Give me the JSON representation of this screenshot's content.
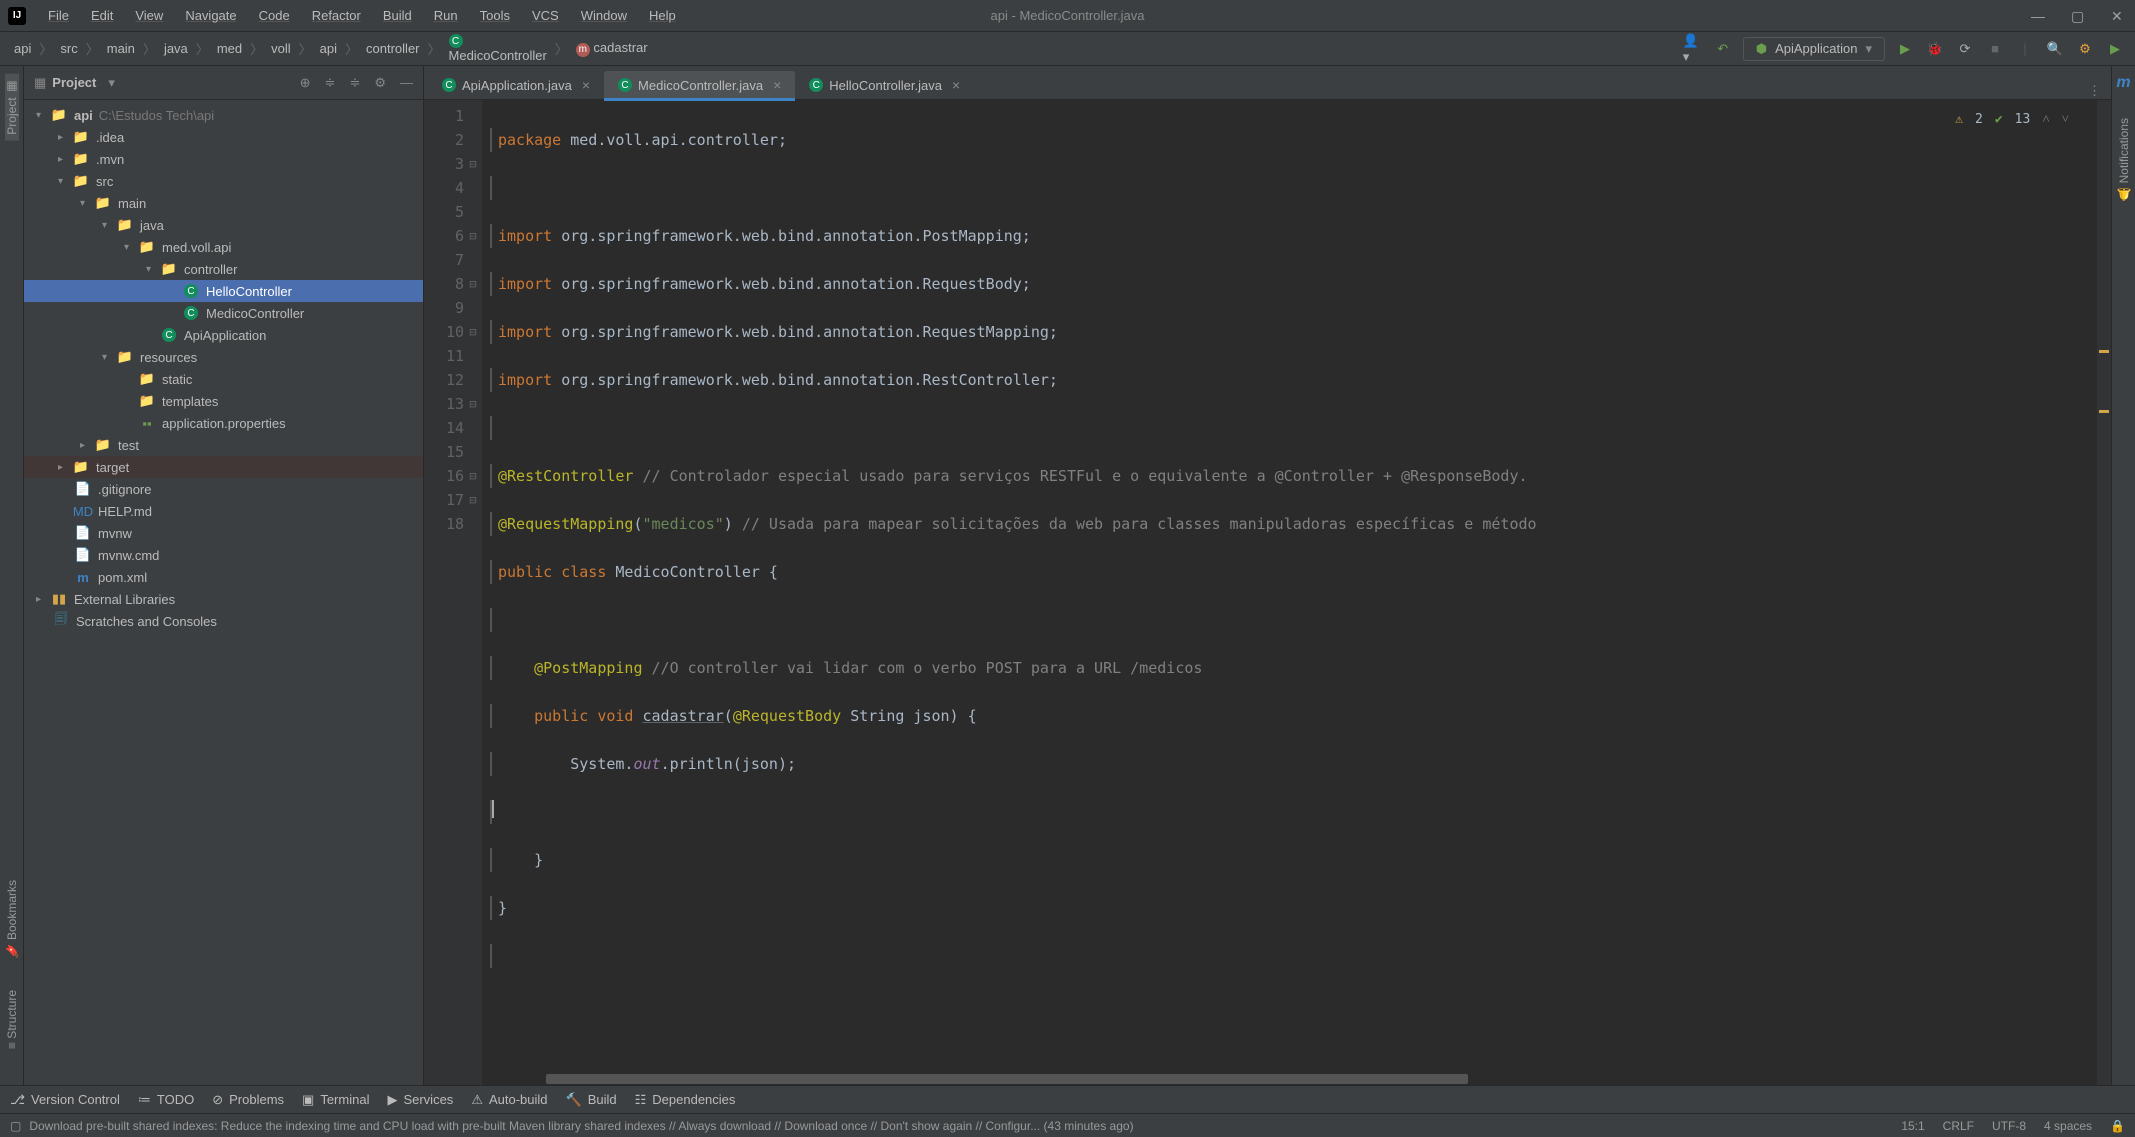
{
  "window": {
    "title": "api - MedicoController.java"
  },
  "menu": [
    "File",
    "Edit",
    "View",
    "Navigate",
    "Code",
    "Refactor",
    "Build",
    "Run",
    "Tools",
    "VCS",
    "Window",
    "Help"
  ],
  "breadcrumb": [
    {
      "label": "api",
      "icon": null
    },
    {
      "label": "src",
      "icon": "folder"
    },
    {
      "label": "main",
      "icon": null
    },
    {
      "label": "java",
      "icon": null
    },
    {
      "label": "med",
      "icon": null
    },
    {
      "label": "voll",
      "icon": null
    },
    {
      "label": "api",
      "icon": null
    },
    {
      "label": "controller",
      "icon": null
    },
    {
      "label": "MedicoController",
      "icon": "class"
    },
    {
      "label": "cadastrar",
      "icon": "method"
    }
  ],
  "run_config": "ApiApplication",
  "project_panel": {
    "title": "Project"
  },
  "tree": {
    "root_name": "api",
    "root_hint": "C:\\Estudos Tech\\api",
    "idea": ".idea",
    "mvn": ".mvn",
    "src": "src",
    "main": "main",
    "java": "java",
    "pkg": "med.voll.api",
    "controller": "controller",
    "hello": "HelloController",
    "medico": "MedicoController",
    "app": "ApiApplication",
    "resources": "resources",
    "static": "static",
    "templates": "templates",
    "props": "application.properties",
    "test": "test",
    "target": "target",
    "gitignore": ".gitignore",
    "help": "HELP.md",
    "mvnw": "mvnw",
    "mvnwcmd": "mvnw.cmd",
    "pom": "pom.xml",
    "ext": "External Libraries",
    "scratch": "Scratches and Consoles"
  },
  "tabs": [
    {
      "label": "ApiApplication.java",
      "active": false
    },
    {
      "label": "MedicoController.java",
      "active": true
    },
    {
      "label": "HelloController.java",
      "active": false
    }
  ],
  "inspections": {
    "warn_count": "2",
    "pass_count": "13"
  },
  "gutter_lines": [
    "1",
    "2",
    "3",
    "4",
    "5",
    "6",
    "7",
    "8",
    "9",
    "10",
    "11",
    "12",
    "13",
    "14",
    "15",
    "16",
    "17",
    "18"
  ],
  "code": {
    "l1_kw": "package",
    "l1_rest": " med.voll.api.controller;",
    "l3_kw": "import",
    "l3_pkg": " org.springframework.web.bind.annotation.",
    "l3_cls": "PostMapping",
    "l3_sc": ";",
    "l4_kw": "import",
    "l4_pkg": " org.springframework.web.bind.annotation.",
    "l4_cls": "RequestBody",
    "l4_sc": ";",
    "l5_kw": "import",
    "l5_pkg": " org.springframework.web.bind.annotation.",
    "l5_cls": "RequestMapping",
    "l5_sc": ";",
    "l6_kw": "import",
    "l6_pkg": " org.springframework.web.bind.annotation.",
    "l6_cls": "RestController",
    "l6_sc": ";",
    "l8_anno": "@RestController",
    "l8_cmt": " // Controlador especial usado para serviços RESTFul e o equivalente a @Controller + @ResponseBody.",
    "l9_anno": "@RequestMapping",
    "l9_par": "(",
    "l9_str": "\"medicos\"",
    "l9_par2": ")",
    "l9_cmt": " // Usada para mapear solicitações da web para classes manipuladoras específicas e método",
    "l10_kw": "public class ",
    "l10_name": "MedicoController",
    "l10_brace": " {",
    "l12_anno": "    @PostMapping",
    "l12_cmt": " //O controller vai lidar com o verbo POST para a URL /medicos",
    "l13_kw": "    public void ",
    "l13_m": "cadastrar",
    "l13_p": "(",
    "l13_anno": "@RequestBody",
    "l13_rest": " String json) {",
    "l14_pre": "        System.",
    "l14_out": "out",
    "l14_rest": ".println(json);",
    "l16": "    }",
    "l17": "}"
  },
  "bottom": [
    "Version Control",
    "TODO",
    "Problems",
    "Terminal",
    "Services",
    "Auto-build",
    "Build",
    "Dependencies"
  ],
  "status": {
    "msg": "Download pre-built shared indexes: Reduce the indexing time and CPU load with pre-built Maven library shared indexes // Always download // Download once // Don't show again // Configur... (43 minutes ago)",
    "pos": "15:1",
    "eol": "CRLF",
    "enc": "UTF-8",
    "indent": "4 spaces"
  },
  "side_left": [
    "Project",
    "Bookmarks",
    "Structure"
  ],
  "side_right": [
    "Notifications"
  ],
  "side_right_top": "m"
}
